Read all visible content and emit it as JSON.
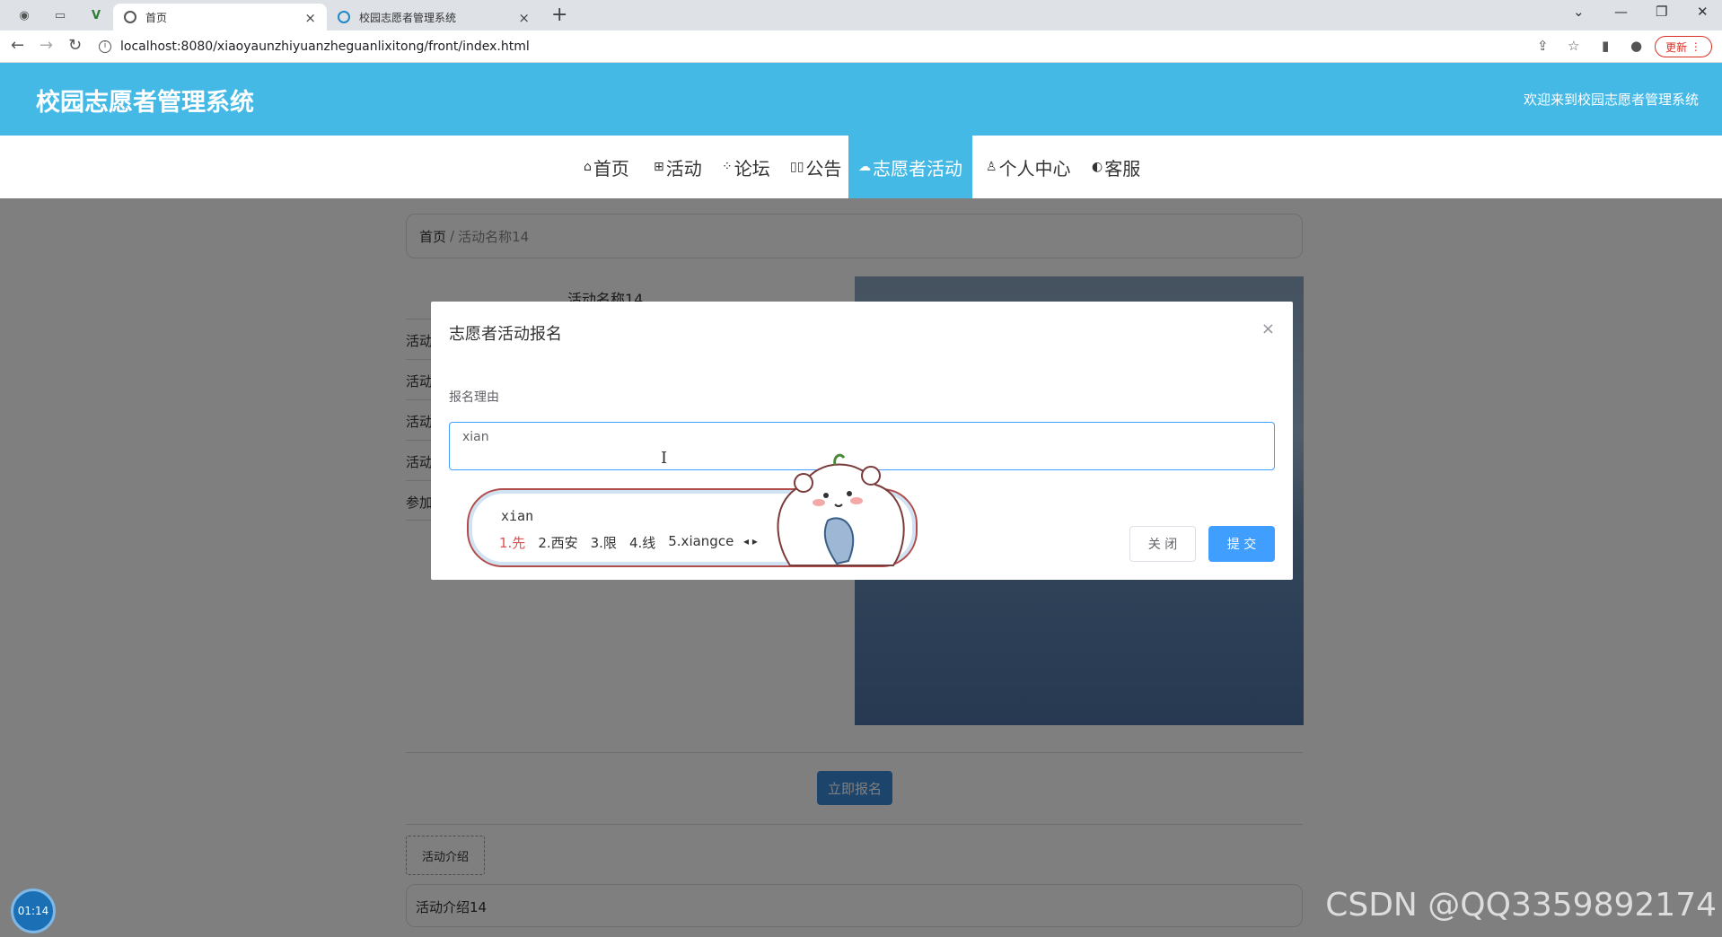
{
  "browser": {
    "tabs": [
      {
        "title": "首页",
        "active": true
      },
      {
        "title": "校园志愿者管理系统",
        "active": false
      }
    ],
    "url": "localhost:8080/xiaoyaunzhiyuanzheguanlixitong/front/index.html",
    "update_label": "更新"
  },
  "header": {
    "title": "校园志愿者管理系统",
    "welcome": "欢迎来到校园志愿者管理系统"
  },
  "nav": {
    "items": [
      {
        "label": "首页",
        "icon": "home-icon"
      },
      {
        "label": "活动",
        "icon": "grid-icon"
      },
      {
        "label": "论坛",
        "icon": "apps-icon"
      },
      {
        "label": "公告",
        "icon": "book-icon"
      },
      {
        "label": "志愿者活动",
        "icon": "helping-icon",
        "active": true
      },
      {
        "label": "个人中心",
        "icon": "user-icon"
      },
      {
        "label": "客服",
        "icon": "chat-icon"
      }
    ]
  },
  "page": {
    "breadcrumb_home": "首页",
    "breadcrumb_sep": "/",
    "breadcrumb_current": "活动名称14",
    "activity_name": "活动名称14",
    "field_rows": [
      "活动",
      "活动",
      "活动",
      "活动",
      "参加"
    ],
    "signup_button": "立即报名",
    "intro_tab": "活动介绍",
    "intro_text": "活动介绍14"
  },
  "dialog": {
    "title": "志愿者活动报名",
    "label": "报名理由",
    "textarea_value": "xian",
    "cancel": "关 闭",
    "submit": "提 交"
  },
  "ime": {
    "pinyin": "xian",
    "candidates": [
      "1.先",
      "2.西安",
      "3.限",
      "4.线",
      "5.xiangce"
    ]
  },
  "timer": "01:14",
  "watermark": "CSDN @QQ3359892174"
}
